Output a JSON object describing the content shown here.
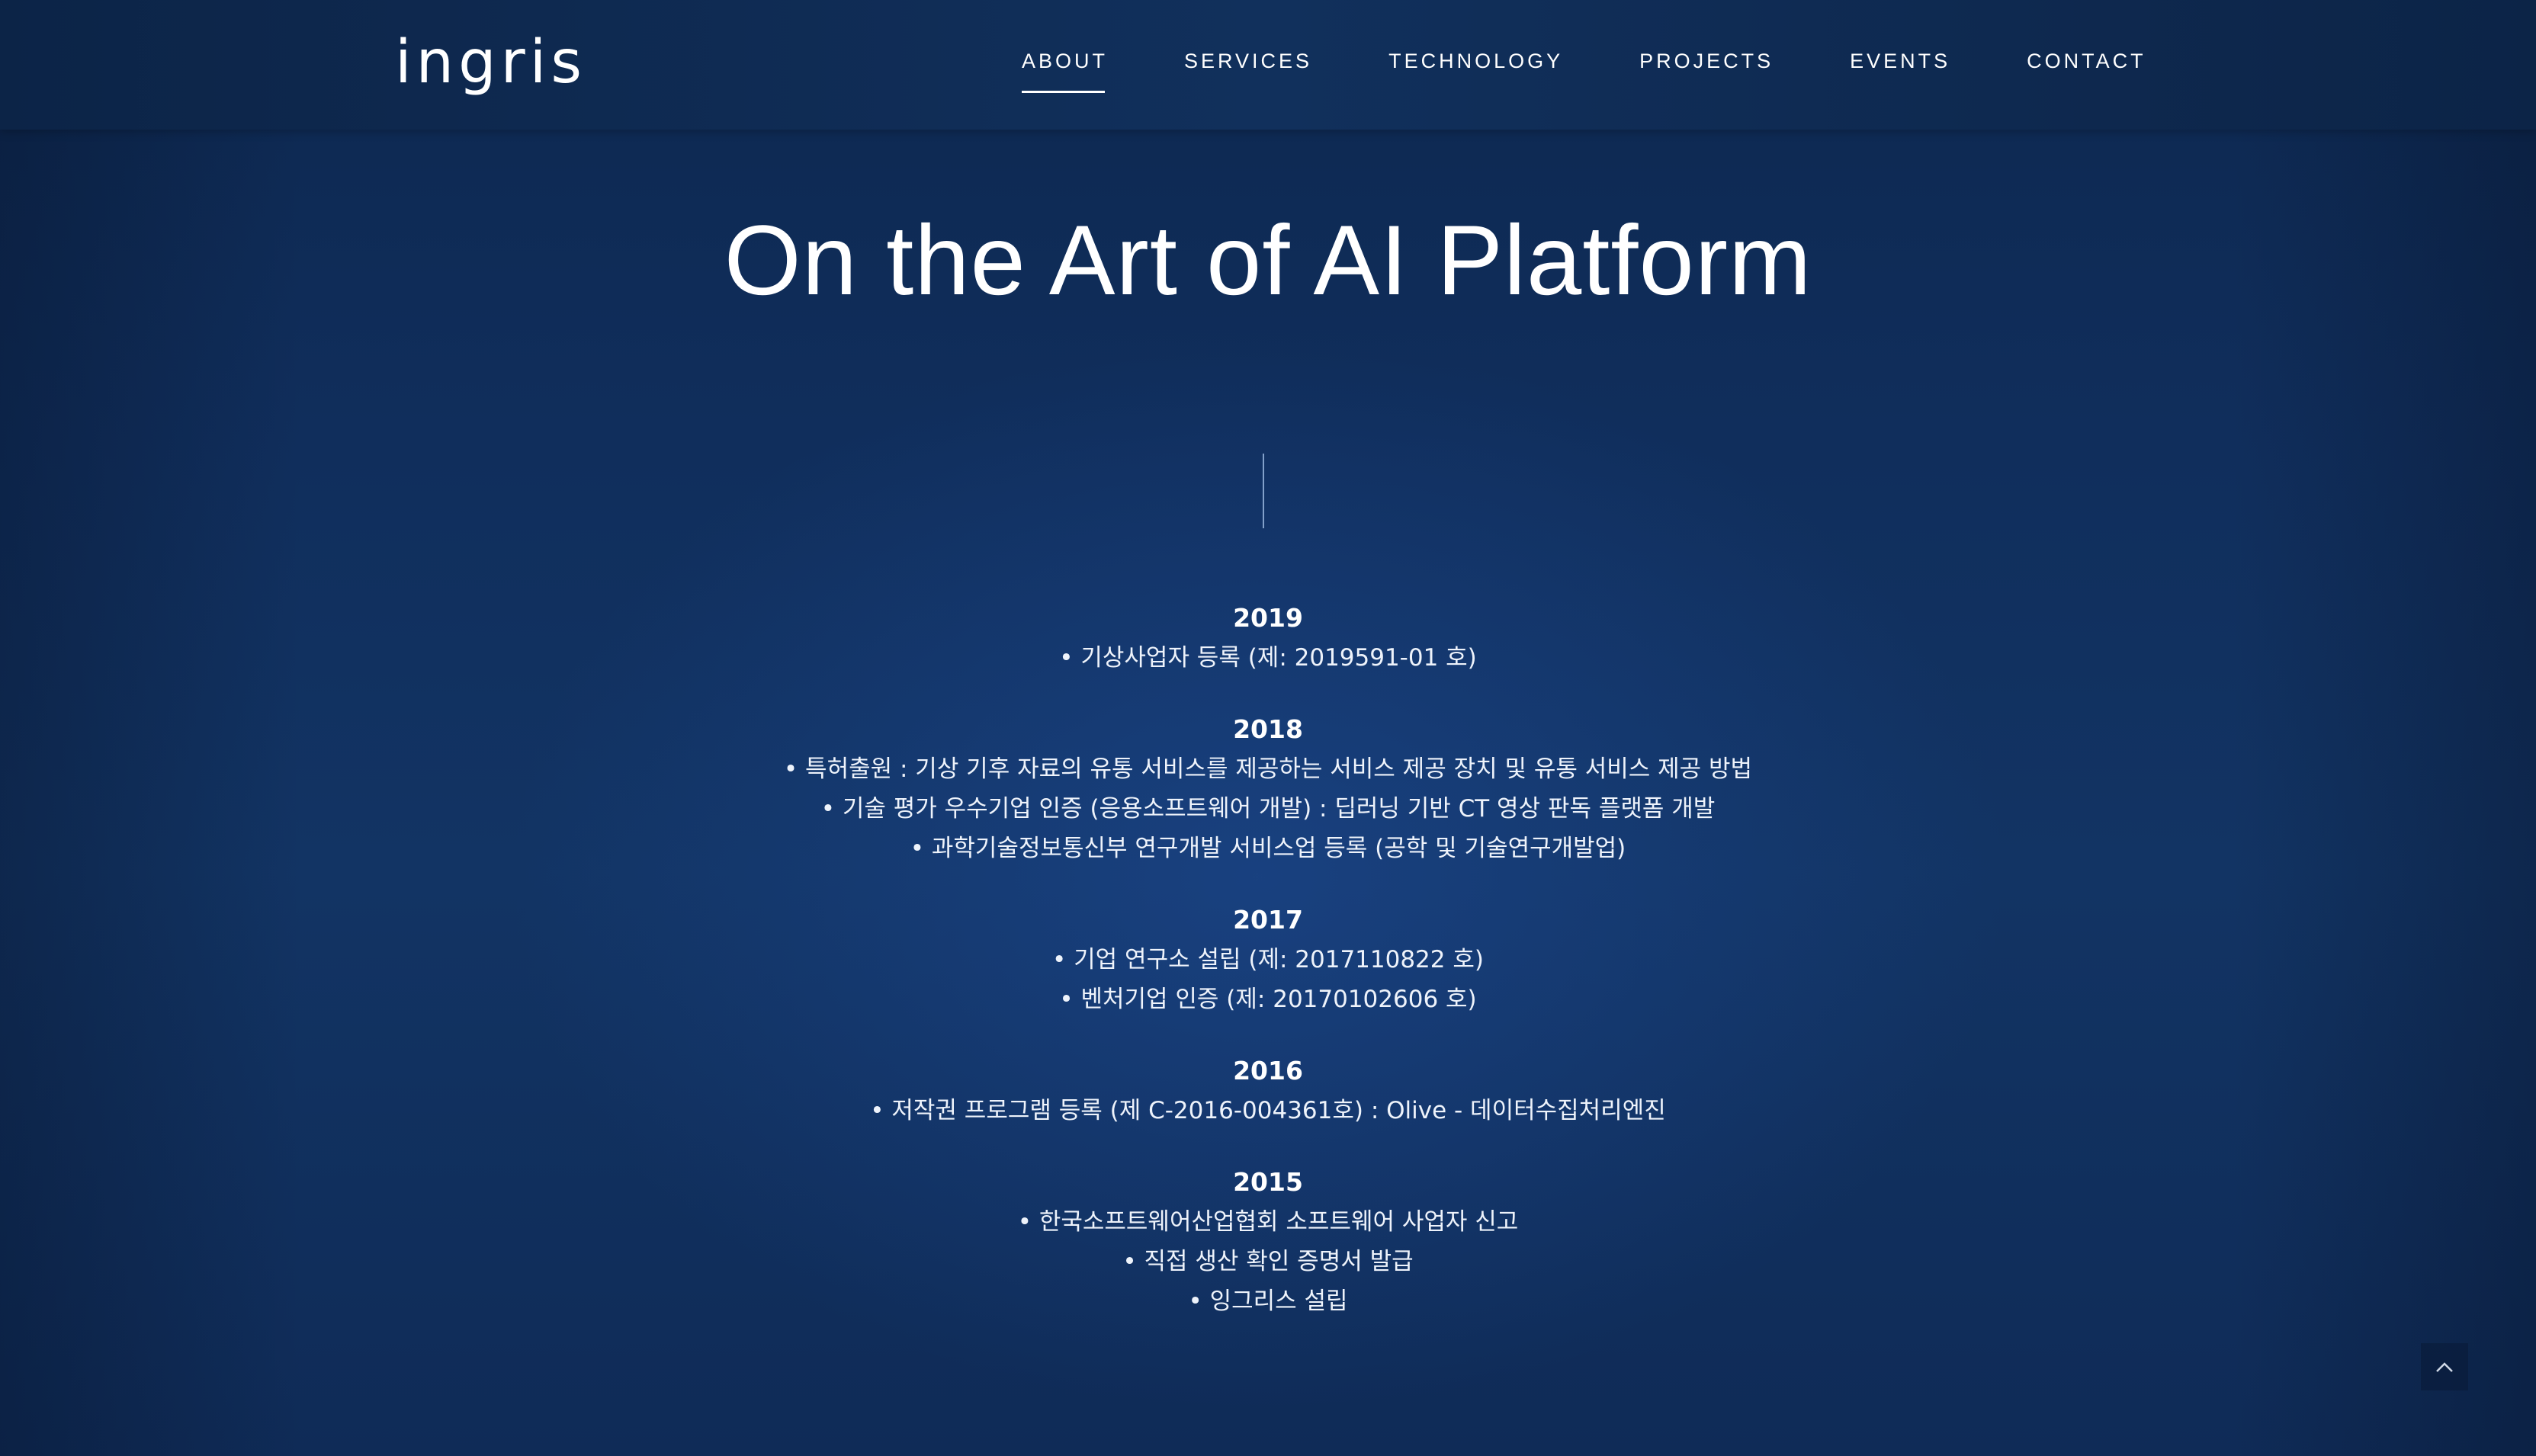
{
  "brand": {
    "logo_text": "ingris"
  },
  "nav": {
    "items": [
      {
        "label": "ABOUT",
        "active": true
      },
      {
        "label": "SERVICES",
        "active": false
      },
      {
        "label": "TECHNOLOGY",
        "active": false
      },
      {
        "label": "PROJECTS",
        "active": false
      },
      {
        "label": "EVENTS",
        "active": false
      },
      {
        "label": "CONTACT",
        "active": false
      }
    ]
  },
  "hero": {
    "title": "On the Art of AI Platform"
  },
  "timeline": [
    {
      "year": "2019",
      "entries": [
        "• 기상사업자 등록 (제: 2019591-01 호)"
      ]
    },
    {
      "year": "2018",
      "entries": [
        "• 특허출원 : 기상 기후 자료의 유통 서비스를 제공하는 서비스 제공 장치 및 유통 서비스 제공 방법",
        "• 기술 평가 우수기업 인증 (응용소프트웨어 개발) : 딥러닝 기반 CT 영상 판독 플랫폼 개발",
        "• 과학기술정보통신부 연구개발 서비스업 등록 (공학 및 기술연구개발업)"
      ]
    },
    {
      "year": "2017",
      "entries": [
        "•  기업 연구소 설립 (제: 2017110822 호)",
        "•  벤처기업 인증 (제: 20170102606 호)"
      ]
    },
    {
      "year": "2016",
      "entries": [
        "•  저작권 프로그램 등록 (제 C-2016-004361호) : Olive - 데이터수집처리엔진"
      ]
    },
    {
      "year": "2015",
      "entries": [
        "•  한국소프트웨어산업협회 소프트웨어 사업자 신고",
        "•  직접 생산 확인 증명서 발급",
        "•  잉그리스 설립"
      ]
    }
  ],
  "icons": {
    "scroll_top": "chevron-up-icon"
  }
}
